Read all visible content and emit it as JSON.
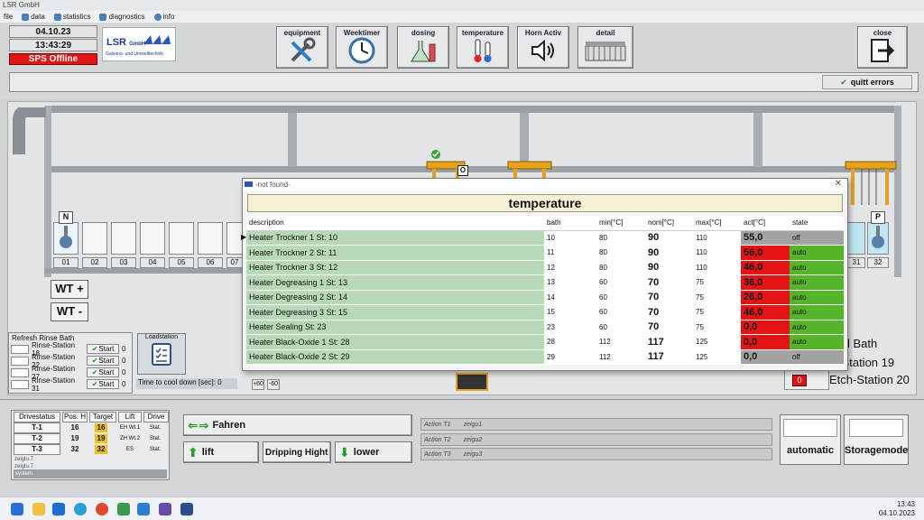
{
  "window": {
    "title": "LSR GmbH"
  },
  "menu": [
    "file",
    "data",
    "statistics",
    "diagnostics",
    "info"
  ],
  "status": {
    "date": "04.10.23",
    "time": "13:43:29",
    "sps": "SPS Offline"
  },
  "logo": {
    "name": "LSR",
    "suffix": "GmbH",
    "tagline": "Galvano- und Umwelttechnik"
  },
  "toolbar": {
    "equipment": "equipment",
    "weektimer": "Weektimer",
    "dosing": "dosing",
    "temperature": "temperature",
    "horn": "Horn Activ",
    "detail": "detail",
    "close": "close"
  },
  "quitt_errors": "quitt errors",
  "plant": {
    "stations": [
      "01",
      "02",
      "03",
      "04",
      "05",
      "06",
      "07"
    ],
    "right_stations": [
      "31",
      "32"
    ],
    "carriers": [
      "N",
      "O",
      "P"
    ],
    "wt_plus": "WT +",
    "wt_minus": "WT -",
    "bath_text": "l Bath",
    "etch19": "h-Station 19",
    "etch20": "Etch-Station 20",
    "etch20_value": "0",
    "cooldown_label": "Time to cool down [sec]:",
    "cooldown_value": "0",
    "small_btns": [
      "+60",
      "-60"
    ],
    "loadstation": "Loadstation"
  },
  "rinse": {
    "title": "Refresh Rinse Bath",
    "rows": [
      {
        "label": "Rinse-Station 18",
        "btn": "Start",
        "val": "0"
      },
      {
        "label": "Rinse-Station 22",
        "btn": "Start",
        "val": "0"
      },
      {
        "label": "Rinse-Station 27",
        "btn": "Start",
        "val": "0"
      },
      {
        "label": "Rinse-Station 31",
        "btn": "Start",
        "val": "0"
      }
    ]
  },
  "dialog": {
    "window_title": "-not found-",
    "header": "temperature",
    "columns": [
      "description",
      "bath",
      "min[°C]",
      "nom[°C]",
      "max[°C]",
      "act[°C]",
      "state"
    ],
    "rows": [
      {
        "desc": "Heater Trockner 1 St: 10",
        "bath": "10",
        "min": "80",
        "nom": "90",
        "max": "110",
        "act": "55,0",
        "state": "off",
        "act_color": "grey",
        "state_color": "grey"
      },
      {
        "desc": "Heater Trockner 2 St: 11",
        "bath": "11",
        "min": "80",
        "nom": "90",
        "max": "110",
        "act": "56,0",
        "state": "auto",
        "act_color": "red",
        "state_color": "green"
      },
      {
        "desc": "Heater Trockner 3 St: 12",
        "bath": "12",
        "min": "80",
        "nom": "90",
        "max": "110",
        "act": "46,0",
        "state": "auto",
        "act_color": "red",
        "state_color": "green"
      },
      {
        "desc": "Heater Degreasing 1 St: 13",
        "bath": "13",
        "min": "60",
        "nom": "70",
        "max": "75",
        "act": "36,0",
        "state": "auto",
        "act_color": "red",
        "state_color": "green"
      },
      {
        "desc": "Heater Degreasing 2 St: 14",
        "bath": "14",
        "min": "60",
        "nom": "70",
        "max": "75",
        "act": "26,0",
        "state": "auto",
        "act_color": "red",
        "state_color": "green"
      },
      {
        "desc": "Heater Degreasing 3 St: 15",
        "bath": "15",
        "min": "60",
        "nom": "70",
        "max": "75",
        "act": "46,0",
        "state": "auto",
        "act_color": "red",
        "state_color": "green"
      },
      {
        "desc": "Heater Sealing St: 23",
        "bath": "23",
        "min": "60",
        "nom": "70",
        "max": "75",
        "act": "0,0",
        "state": "auto",
        "act_color": "red",
        "state_color": "green"
      },
      {
        "desc": "Heater Black-Oxide 1 St: 28",
        "bath": "28",
        "min": "112",
        "nom": "117",
        "max": "125",
        "act": "0,0",
        "state": "auto",
        "act_color": "red",
        "state_color": "green"
      },
      {
        "desc": "Heater Black-Oxide 2 St: 29",
        "bath": "29",
        "min": "112",
        "nom": "117",
        "max": "125",
        "act": "0,0",
        "state": "off",
        "act_color": "grey",
        "state_color": "grey"
      }
    ]
  },
  "drives": {
    "headers": [
      "Drivestatus",
      "Pos. H",
      "Target",
      "Lift",
      "Drive"
    ],
    "rows": [
      {
        "name": "T-1",
        "pos": "16",
        "target": "16",
        "lift": "EH Wt.1",
        "drive": "Stat."
      },
      {
        "name": "T-2",
        "pos": "19",
        "target": "19",
        "lift": "ZH Wt.2",
        "drive": "Stat."
      },
      {
        "name": "T-3",
        "pos": "32",
        "target": "32",
        "lift": "ES",
        "drive": "Stat."
      }
    ],
    "notes": [
      "zeigtu.7",
      "zeigtu.7",
      "system"
    ]
  },
  "controls": {
    "fahren": "Fahren",
    "lift": "lift",
    "dripping": "Dripping Hight",
    "lower": "lower",
    "automatic": "automatic",
    "storagemode": "Storagemode"
  },
  "actions": [
    {
      "label": "Action T1",
      "value": "zeigu1"
    },
    {
      "label": "Action T2",
      "value": "zeigu2"
    },
    {
      "label": "Action T3",
      "value": "zeigu3"
    }
  ],
  "taskbar": {
    "time": "13:43",
    "date": "04.10.2023"
  }
}
